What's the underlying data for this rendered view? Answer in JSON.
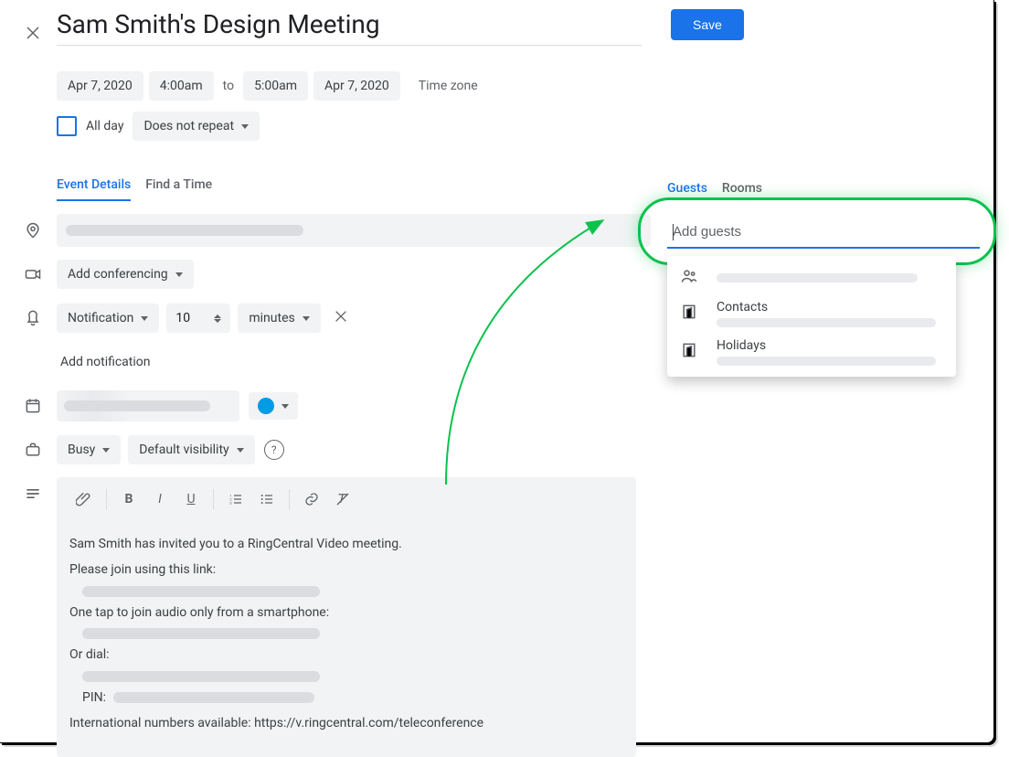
{
  "header": {
    "title": "Sam Smith's Design Meeting",
    "save_label": "Save"
  },
  "datetime": {
    "start_date": "Apr 7, 2020",
    "start_time": "4:00am",
    "to_label": "to",
    "end_time": "5:00am",
    "end_date": "Apr 7, 2020",
    "timezone_label": "Time zone"
  },
  "options": {
    "all_day_label": "All day",
    "repeat_label": "Does not repeat"
  },
  "tabs": {
    "details": "Event Details",
    "find_time": "Find a Time"
  },
  "conferencing": {
    "add_label": "Add conferencing"
  },
  "notification": {
    "type_label": "Notification",
    "value": "10",
    "unit_label": "minutes",
    "add_label": "Add notification"
  },
  "availability": {
    "busy_label": "Busy",
    "visibility_label": "Default visibility"
  },
  "description": {
    "line1": "Sam Smith has invited you to a RingCentral Video meeting.",
    "line2": "Please join using this link:",
    "line3": "One tap to join audio only from a smartphone:",
    "line4": "Or dial:",
    "pin_label": "PIN:",
    "line5": "International numbers available: https://v.ringcentral.com/teleconference"
  },
  "right_panel": {
    "guests_tab": "Guests",
    "rooms_tab": "Rooms",
    "add_guests_placeholder": "Add guests",
    "suggestions": [
      {
        "label": ""
      },
      {
        "label": "Contacts"
      },
      {
        "label": "Holidays"
      }
    ]
  },
  "colors": {
    "event_color": "#039be5"
  }
}
